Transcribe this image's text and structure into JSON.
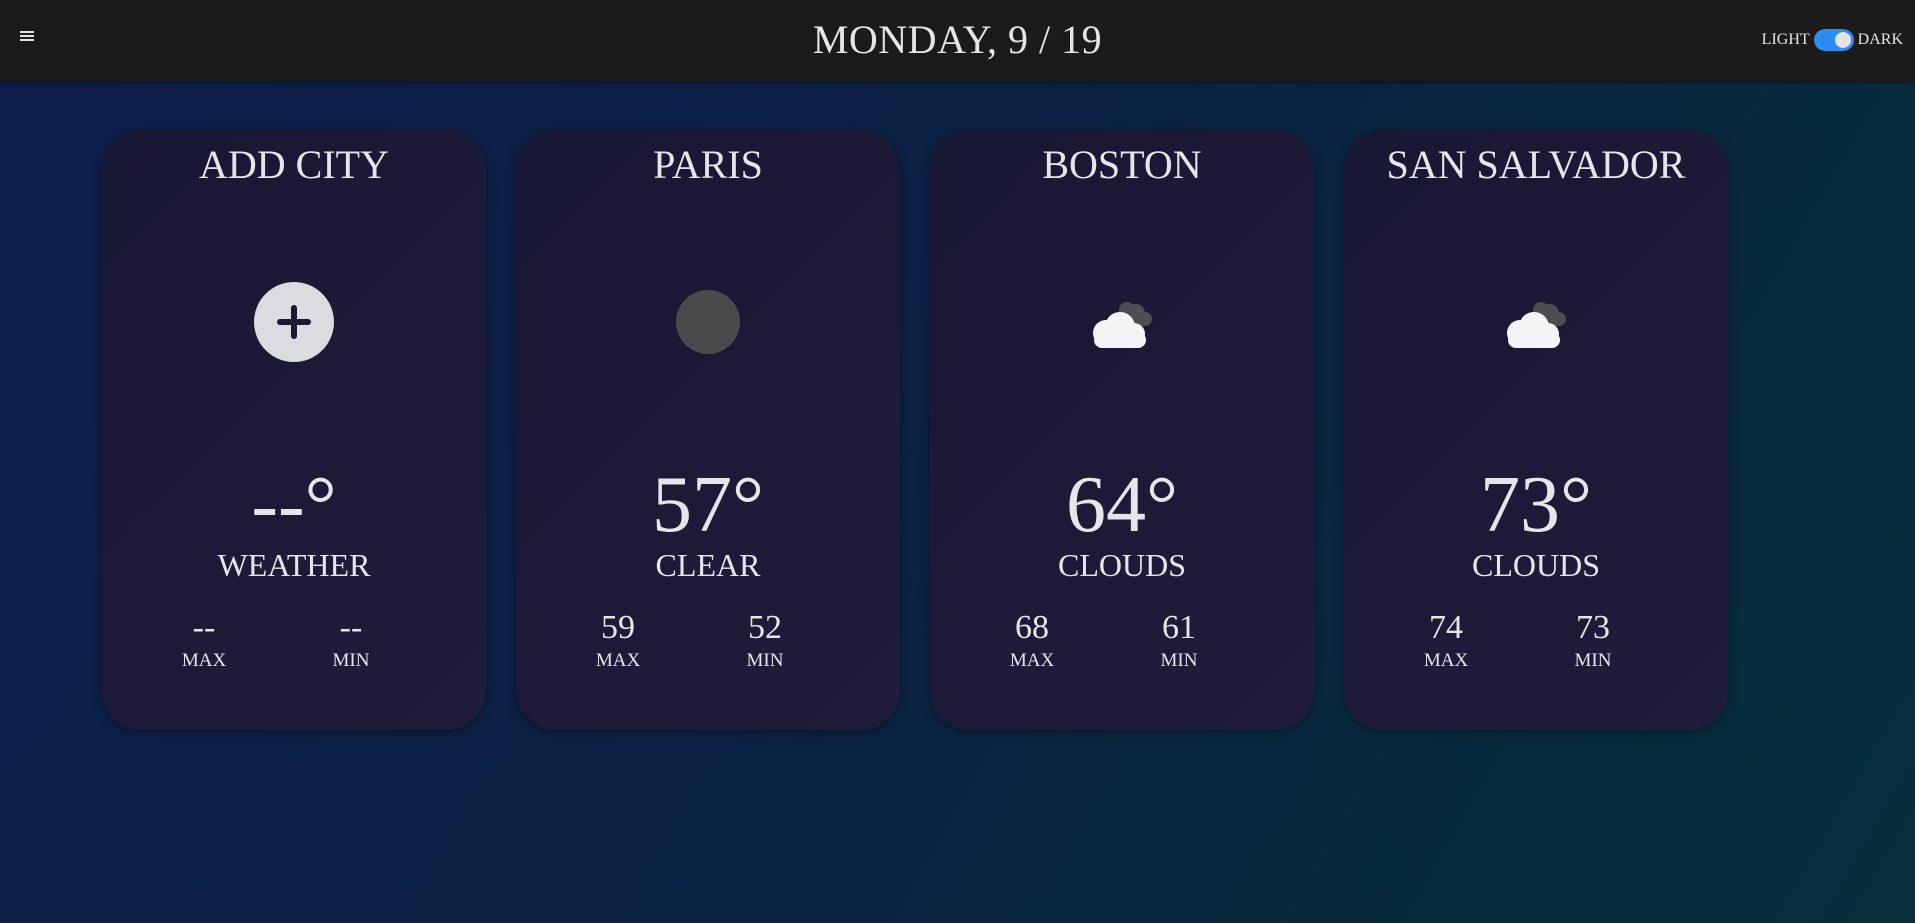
{
  "header": {
    "title": "MONDAY, 9 / 19",
    "menu_icon": "hamburger-menu-icon",
    "theme": {
      "light_label": "LIGHT",
      "dark_label": "DARK",
      "mode": "dark",
      "accent": "#2d8cf0"
    }
  },
  "cards": [
    {
      "city": "ADD CITY",
      "icon": "plus-circle-icon",
      "temp": "--°",
      "condition": "WEATHER",
      "max": "--",
      "max_label": "MAX",
      "min": "--",
      "min_label": "MIN"
    },
    {
      "city": "PARIS",
      "icon": "moon-icon",
      "temp": "57°",
      "condition": "CLEAR",
      "max": "59",
      "max_label": "MAX",
      "min": "52",
      "min_label": "MIN"
    },
    {
      "city": "BOSTON",
      "icon": "cloud-icon",
      "temp": "64°",
      "condition": "CLOUDS",
      "max": "68",
      "max_label": "MAX",
      "min": "61",
      "min_label": "MIN"
    },
    {
      "city": "SAN SALVADOR",
      "icon": "cloud-icon",
      "temp": "73°",
      "condition": "CLOUDS",
      "max": "74",
      "max_label": "MAX",
      "min": "73",
      "min_label": "MIN"
    }
  ]
}
